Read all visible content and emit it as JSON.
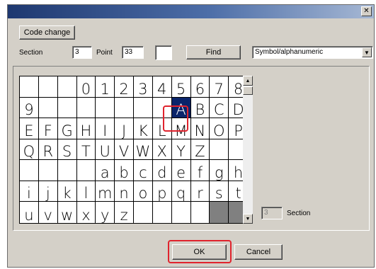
{
  "window": {
    "close_glyph": "✕"
  },
  "toolbar": {
    "code_change_label": "Code change",
    "section_label": "Section",
    "section_value": "3",
    "point_label": "Point",
    "point_value": "33",
    "preview_value": "",
    "find_label": "Find",
    "charset_selected": "Symbol/alphanumeric"
  },
  "grid": {
    "rows": [
      [
        "",
        "",
        "",
        "",
        "",
        "",
        "",
        "",
        "",
        "",
        "",
        ""
      ],
      [
        "",
        "",
        "",
        "0",
        "1",
        "2",
        "3",
        "4",
        "5",
        "6",
        "7",
        "8"
      ],
      [
        "9",
        "",
        "",
        "",
        "",
        "",
        "",
        "",
        "A",
        "B",
        "C",
        "D"
      ],
      [
        "E",
        "F",
        "G",
        "H",
        "I",
        "J",
        "K",
        "L",
        "M",
        "N",
        "O",
        "P"
      ],
      [
        "Q",
        "R",
        "S",
        "T",
        "U",
        "V",
        "W",
        "X",
        "Y",
        "Z",
        "",
        ""
      ],
      [
        "",
        "",
        "",
        "",
        "a",
        "b",
        "c",
        "d",
        "e",
        "f",
        "g",
        "h"
      ],
      [
        "i",
        "j",
        "k",
        "l",
        "m",
        "n",
        "o",
        "p",
        "q",
        "r",
        "s",
        "t"
      ],
      [
        "u",
        "v",
        "w",
        "x",
        "y",
        "z",
        "",
        "",
        "",
        "",
        "",
        ""
      ]
    ],
    "selected": "A"
  },
  "section_box": {
    "value": "3",
    "label": "Section"
  },
  "footer": {
    "ok_label": "OK",
    "cancel_label": "Cancel"
  },
  "scroll": {
    "up_glyph": "▲",
    "down_glyph": "▼"
  },
  "colors": {
    "highlight": "#e0232d",
    "selection": "#0a246a"
  }
}
